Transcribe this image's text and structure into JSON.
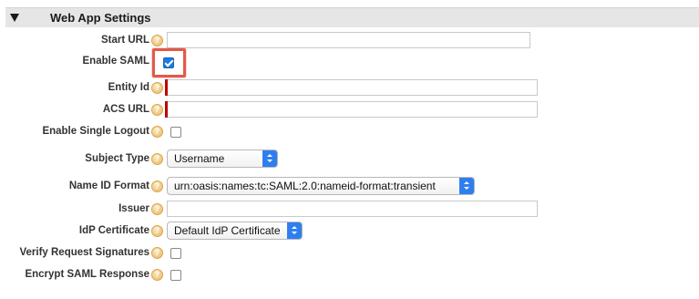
{
  "section": {
    "title": "Web App Settings",
    "collapse_icon": "triangle-down-icon"
  },
  "fields": {
    "start_url": {
      "label": "Start URL",
      "value": "",
      "placeholder": ""
    },
    "enable_saml": {
      "label": "Enable SAML",
      "checked": true
    },
    "entity_id": {
      "label": "Entity Id",
      "value": "",
      "placeholder": ""
    },
    "acs_url": {
      "label": "ACS URL",
      "value": "",
      "placeholder": ""
    },
    "enable_single_logout": {
      "label": "Enable Single Logout",
      "checked": false
    },
    "subject_type": {
      "label": "Subject Type",
      "selected": "Username"
    },
    "name_id_format": {
      "label": "Name ID Format",
      "selected": "urn:oasis:names:tc:SAML:2.0:nameid-format:transient"
    },
    "issuer": {
      "label": "Issuer",
      "value": "",
      "placeholder": ""
    },
    "idp_certificate": {
      "label": "IdP Certificate",
      "selected": "Default IdP Certificate"
    },
    "verify_request_signatures": {
      "label": "Verify Request Signatures",
      "checked": false
    },
    "encrypt_saml_response": {
      "label": "Encrypt SAML Response",
      "checked": false
    }
  },
  "help_icon_glyph": "?",
  "colors": {
    "required": "#c00000",
    "checkbox_checked": "#1f7ae0",
    "highlight": "#e25a4b",
    "select_arrow": "#2f7ef0"
  }
}
